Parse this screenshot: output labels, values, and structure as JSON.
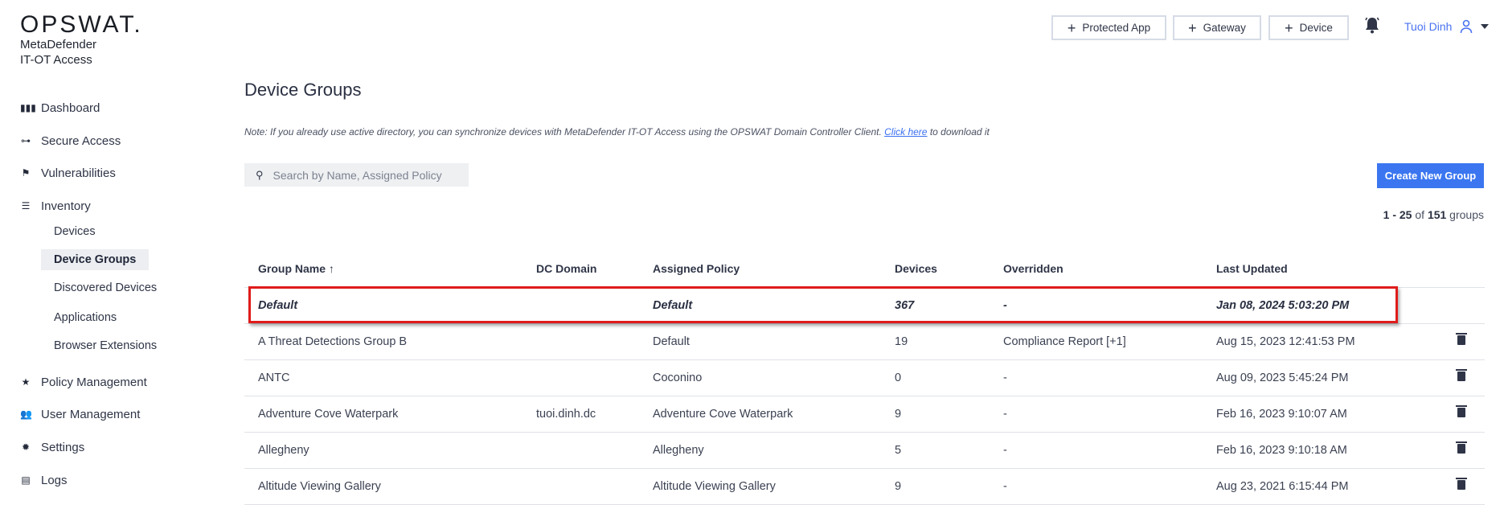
{
  "brand": {
    "logo": "OPSWAT.",
    "product_line1": "MetaDefender",
    "product_line2": "IT-OT Access"
  },
  "header": {
    "protected_app": "Protected App",
    "gateway": "Gateway",
    "device": "Device",
    "user_name": "Tuoi Dinh"
  },
  "sidebar": {
    "items": [
      {
        "label": "Dashboard",
        "icon": "dashboard-icon"
      },
      {
        "label": "Secure Access",
        "icon": "key-icon"
      },
      {
        "label": "Vulnerabilities",
        "icon": "flag-icon"
      },
      {
        "label": "Inventory",
        "icon": "list-icon"
      },
      {
        "label": "Policy Management",
        "icon": "star-icon"
      },
      {
        "label": "User Management",
        "icon": "users-icon"
      },
      {
        "label": "Settings",
        "icon": "gear-icon"
      },
      {
        "label": "Logs",
        "icon": "clipboard-icon"
      }
    ],
    "inventory_sub": [
      "Devices",
      "Device Groups",
      "Discovered Devices",
      "Applications",
      "Browser Extensions"
    ]
  },
  "main": {
    "title": "Device Groups",
    "note_before": "Note: If you already use active directory, you can synchronize devices with MetaDefender IT-OT Access using the OPSWAT Domain Controller Client. ",
    "note_link": "Click here",
    "note_after": " to download it",
    "search_placeholder": "Search by Name, Assigned Policy",
    "create_button": "Create New Group",
    "count": {
      "from": "1",
      "sep": " - ",
      "to": "25",
      "of": " of ",
      "total": "151",
      "suffix": " groups"
    }
  },
  "table": {
    "headers": [
      "Group Name ↑",
      "DC Domain",
      "Assigned Policy",
      "Devices",
      "Overridden",
      "Last Updated"
    ],
    "rows": [
      [
        "Default",
        "",
        "Default",
        "367",
        "-",
        "Jan 08, 2024 5:03:20 PM"
      ],
      [
        "A Threat Detections Group B",
        "",
        "Default",
        "19",
        "Compliance Report [+1]",
        "Aug 15, 2023 12:41:53 PM"
      ],
      [
        "ANTC",
        "",
        "Coconino",
        "0",
        "-",
        "Aug 09, 2023 5:45:24 PM"
      ],
      [
        "Adventure Cove Waterpark",
        "tuoi.dinh.dc",
        "Adventure Cove Waterpark",
        "9",
        "-",
        "Feb 16, 2023 9:10:07 AM"
      ],
      [
        "Allegheny",
        "",
        "Allegheny",
        "5",
        "-",
        "Feb 16, 2023 9:10:18 AM"
      ],
      [
        "Altitude Viewing Gallery",
        "",
        "Altitude Viewing Gallery",
        "9",
        "-",
        "Aug 23, 2021 6:15:44 PM"
      ]
    ]
  },
  "colors": {
    "accent": "#3b76f0",
    "highlight": "#e01b1b"
  }
}
